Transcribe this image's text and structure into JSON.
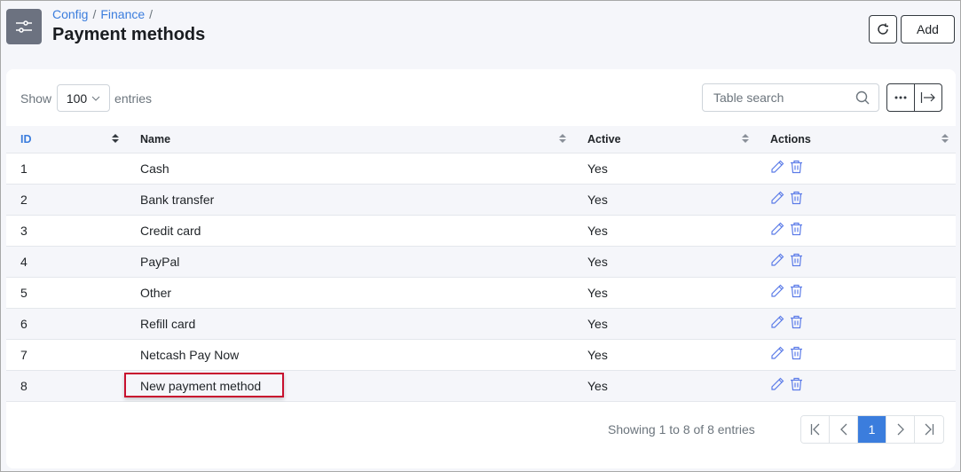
{
  "header": {
    "breadcrumb": [
      "Config",
      "Finance"
    ],
    "title": "Payment methods",
    "icon": "sliders-icon",
    "refresh_icon": "refresh-icon",
    "add_label": "Add"
  },
  "controls": {
    "show_label": "Show",
    "page_length": "100",
    "entries_label": "entries",
    "search_placeholder": "Table search",
    "search_value": ""
  },
  "table": {
    "columns": [
      "ID",
      "Name",
      "Active",
      "Actions"
    ],
    "rows": [
      {
        "id": "1",
        "name": "Cash",
        "active": "Yes"
      },
      {
        "id": "2",
        "name": "Bank transfer",
        "active": "Yes"
      },
      {
        "id": "3",
        "name": "Credit card",
        "active": "Yes"
      },
      {
        "id": "4",
        "name": "PayPal",
        "active": "Yes"
      },
      {
        "id": "5",
        "name": "Other",
        "active": "Yes"
      },
      {
        "id": "6",
        "name": "Refill card",
        "active": "Yes"
      },
      {
        "id": "7",
        "name": "Netcash Pay Now",
        "active": "Yes"
      },
      {
        "id": "8",
        "name": "New payment method",
        "active": "Yes",
        "highlighted": true
      }
    ]
  },
  "footer": {
    "info": "Showing 1 to 8 of 8 entries",
    "current_page": "1"
  },
  "colors": {
    "accent": "#3b7ddd",
    "highlight_border": "#c8102e",
    "action_icon": "#5b7be8"
  }
}
